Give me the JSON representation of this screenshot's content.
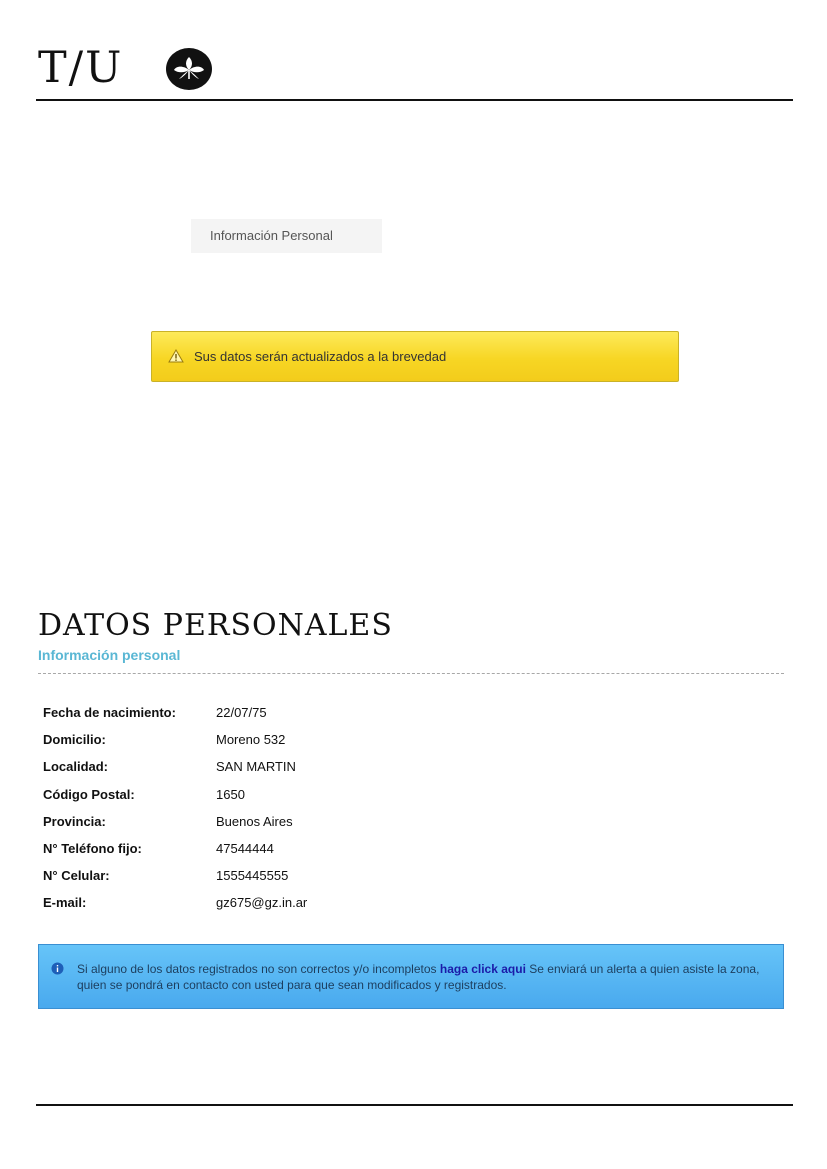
{
  "header": {
    "logo_text": "T/U",
    "emblem_icon": "flower-emblem-icon"
  },
  "tab": {
    "label": "Información Personal"
  },
  "alert": {
    "icon": "warning-triangle-icon",
    "message": "Sus datos serán actualizados a la brevedad"
  },
  "section": {
    "title": "DATOS PERSONALES",
    "subtitle": "Información personal"
  },
  "fields": [
    {
      "label": "Fecha de nacimiento:",
      "value": "22/07/75"
    },
    {
      "label": "Domicilio:",
      "value": "Moreno 532"
    },
    {
      "label": "Localidad:",
      "value": "SAN MARTIN"
    },
    {
      "label": "Código Postal:",
      "value": "1650"
    },
    {
      "label": "Provincia:",
      "value": "Buenos Aires"
    },
    {
      "label": "N° Teléfono fijo:",
      "value": "47544444"
    },
    {
      "label": "N° Celular:",
      "value": "1555445555"
    },
    {
      "label": "E-mail:",
      "value": "gz675@gz.in.ar"
    }
  ],
  "info": {
    "icon": "info-circle-icon",
    "text_before": "Si alguno de los datos registrados no son correctos y/o incompletos ",
    "link": "haga click aqui",
    "text_after": "  Se enviará un alerta a quien asiste la zona, quien se pondrá en contacto con usted para que sean modificados y registrados."
  },
  "colors": {
    "accent": "#5ab7d4",
    "warning": "#f7d624",
    "info": "#49a9ee"
  }
}
